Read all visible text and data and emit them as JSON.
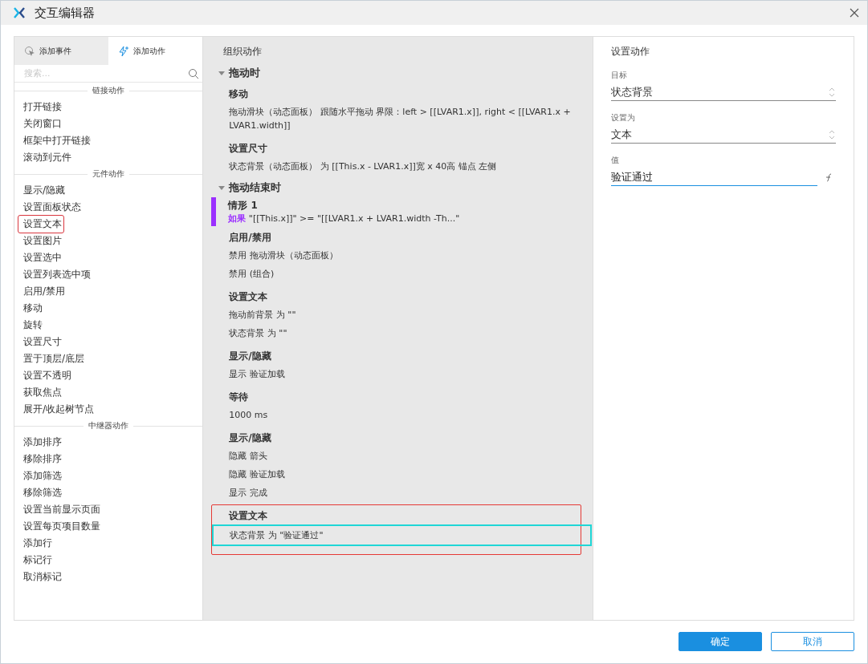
{
  "window": {
    "title": "交互编辑器"
  },
  "left_panel": {
    "tabs": [
      {
        "label": "添加事件",
        "selected": false,
        "kind": "event"
      },
      {
        "label": "添加动作",
        "selected": true,
        "kind": "action"
      }
    ],
    "search": {
      "placeholder": "搜索..."
    },
    "sections": [
      {
        "title": "链接动作",
        "items": [
          {
            "label": "打开链接",
            "marked": false
          },
          {
            "label": "关闭窗口",
            "marked": false
          },
          {
            "label": "框架中打开链接",
            "marked": false
          },
          {
            "label": "滚动到元件",
            "marked": false
          }
        ]
      },
      {
        "title": "元件动作",
        "items": [
          {
            "label": "显示/隐藏",
            "marked": false
          },
          {
            "label": "设置面板状态",
            "marked": false
          },
          {
            "label": "设置文本",
            "marked": true
          },
          {
            "label": "设置图片",
            "marked": false
          },
          {
            "label": "设置选中",
            "marked": false
          },
          {
            "label": "设置列表选中项",
            "marked": false
          },
          {
            "label": "启用/禁用",
            "marked": false
          },
          {
            "label": "移动",
            "marked": false
          },
          {
            "label": "旋转",
            "marked": false
          },
          {
            "label": "设置尺寸",
            "marked": false
          },
          {
            "label": "置于顶层/底层",
            "marked": false
          },
          {
            "label": "设置不透明",
            "marked": false
          },
          {
            "label": "获取焦点",
            "marked": false
          },
          {
            "label": "展开/收起树节点",
            "marked": false
          }
        ]
      },
      {
        "title": "中继器动作",
        "items": [
          {
            "label": "添加排序",
            "marked": false
          },
          {
            "label": "移除排序",
            "marked": false
          },
          {
            "label": "添加筛选",
            "marked": false
          },
          {
            "label": "移除筛选",
            "marked": false
          },
          {
            "label": "设置当前显示页面",
            "marked": false
          },
          {
            "label": "设置每页项目数量",
            "marked": false
          },
          {
            "label": "添加行",
            "marked": false
          },
          {
            "label": "标记行",
            "marked": false
          },
          {
            "label": "取消标记",
            "marked": false
          }
        ]
      }
    ]
  },
  "middle_panel": {
    "title": "组织动作",
    "events": [
      {
        "title": "拖动时",
        "expanded": true,
        "blocks": [
          {
            "kind": "action",
            "title": "移动",
            "marked": false,
            "lines": [
              {
                "text": "拖动滑块（动态面板） 跟随水平拖动 界限：left > [[LVAR1.x]], right < [[LVAR1.x + LVAR1.width]]",
                "highlighted": false
              }
            ]
          },
          {
            "kind": "action",
            "title": "设置尺寸",
            "marked": false,
            "lines": [
              {
                "text": "状态背景（动态面板） 为 [[This.x - LVAR1.x]]宽 x 40高  锚点 左侧",
                "highlighted": false
              }
            ]
          }
        ]
      },
      {
        "title": "拖动结束时",
        "expanded": true,
        "blocks": [
          {
            "kind": "case",
            "title": "情形 1",
            "keyword": "如果",
            "condition": "\"[[This.x]]\" >= \"[[LVAR1.x + LVAR1.width -Th...\""
          },
          {
            "kind": "action",
            "title": "启用/禁用",
            "marked": false,
            "lines": [
              {
                "text": "禁用 拖动滑块（动态面板）",
                "highlighted": false
              },
              {
                "text": "禁用 (组合)",
                "highlighted": false
              }
            ]
          },
          {
            "kind": "action",
            "title": "设置文本",
            "marked": false,
            "lines": [
              {
                "text": "拖动前背景 为 \"\"",
                "highlighted": false
              },
              {
                "text": "状态背景 为 \"\"",
                "highlighted": false
              }
            ]
          },
          {
            "kind": "action",
            "title": "显示/隐藏",
            "marked": false,
            "lines": [
              {
                "text": "显示 验证加载",
                "highlighted": false
              }
            ]
          },
          {
            "kind": "action",
            "title": "等待",
            "marked": false,
            "lines": [
              {
                "text": "1000 ms",
                "highlighted": false
              }
            ]
          },
          {
            "kind": "action",
            "title": "显示/隐藏",
            "marked": false,
            "lines": [
              {
                "text": "隐藏 箭头",
                "highlighted": false
              },
              {
                "text": "隐藏 验证加载",
                "highlighted": false
              },
              {
                "text": "显示 完成",
                "highlighted": false
              }
            ]
          },
          {
            "kind": "action",
            "title": "设置文本",
            "marked": true,
            "lines": [
              {
                "text": "状态背景 为 \"验证通过\"",
                "highlighted": true
              }
            ]
          }
        ]
      }
    ]
  },
  "right_panel": {
    "title": "设置动作",
    "fields": [
      {
        "kind": "select",
        "label": "目标",
        "value": "状态背景"
      },
      {
        "kind": "select",
        "label": "设置为",
        "value": "文本"
      },
      {
        "kind": "text",
        "label": "值",
        "value": "验证通过"
      }
    ]
  },
  "buttons": [
    {
      "label": "确定",
      "kind": "primary"
    },
    {
      "label": "取消",
      "kind": "secondary"
    }
  ]
}
